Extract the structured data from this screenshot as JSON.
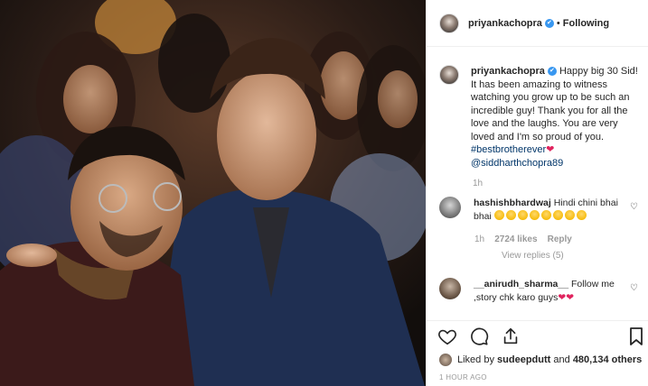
{
  "post": {
    "username": "priyankachopra",
    "follow_label": "Following",
    "dot": "•",
    "caption_user": "priyankachopra",
    "caption_text": "Happy big 30 Sid! It has been amazing to witness watching you grow up to be such an incredible guy! Thank you for all the love and the laughs. You are very loved and I'm so proud of you.",
    "caption_hashtag": "#bestbrotherever",
    "caption_mention": "@siddharthchopra89",
    "caption_time": "1h"
  },
  "comments": [
    {
      "user": "hashishbhardwaj",
      "text": "Hindi chini bhai bhai",
      "time": "1h",
      "likes": "2724 likes",
      "reply": "Reply",
      "view_replies": "View replies (5)"
    },
    {
      "user": "__anirudh_sharma__",
      "text": "Follow me ,story chk karo guys"
    }
  ],
  "likes": {
    "prefix": "Liked by",
    "user": "sudeepdutt",
    "middle": "and",
    "count": "480,134 others"
  },
  "timestamp": "1 HOUR AGO",
  "icons": {
    "like": "heart-icon",
    "comment": "comment-icon",
    "share": "share-icon",
    "save": "bookmark-icon"
  },
  "colors": {
    "link": "#003569",
    "verified": "#3897f0",
    "heart": "#e0245e",
    "muted": "#999999"
  }
}
